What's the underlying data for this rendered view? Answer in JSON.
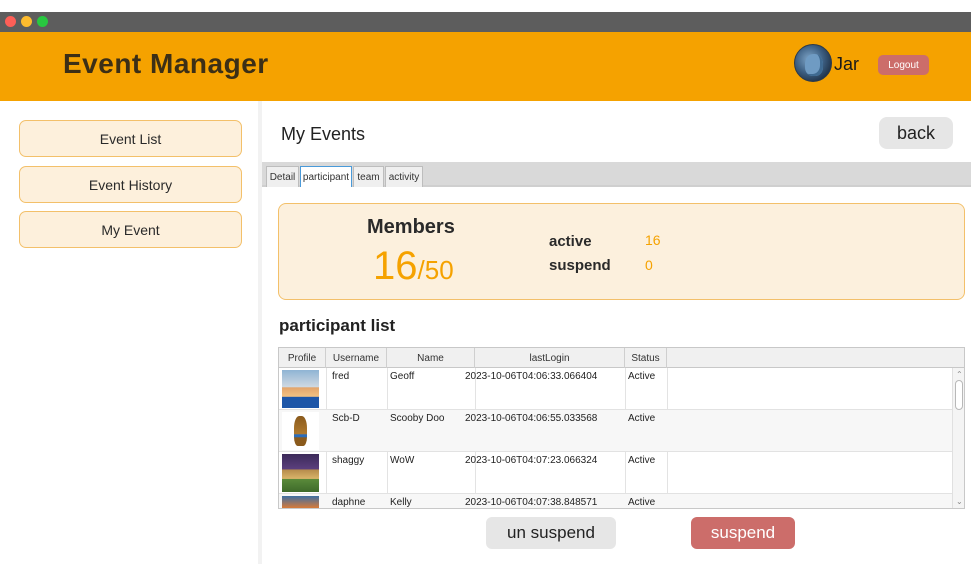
{
  "header": {
    "app_title": "Event Manager",
    "user_name": "Jar",
    "logout_label": "Logout"
  },
  "sidebar": {
    "items": [
      {
        "label": "Event List"
      },
      {
        "label": "Event History"
      },
      {
        "label": "My Event"
      }
    ]
  },
  "main": {
    "page_title": "My Events",
    "back_label": "back",
    "tabs": [
      {
        "label": "Detail"
      },
      {
        "label": "participant"
      },
      {
        "label": "team"
      },
      {
        "label": "activity"
      }
    ],
    "members": {
      "label": "Members",
      "current": "16",
      "separator": "/",
      "max": "50",
      "active_label": "active",
      "active_value": "16",
      "suspend_label": "suspend",
      "suspend_value": "0"
    },
    "list_title": "participant list",
    "table": {
      "columns": [
        "Profile",
        "Username",
        "Name",
        "lastLogin",
        "Status"
      ],
      "rows": [
        {
          "username": "fred",
          "name": "Geoff",
          "last_login": "2023-10-06T04:06:33.066404",
          "status": "Active"
        },
        {
          "username": "Scb-D",
          "name": "Scooby Doo",
          "last_login": "2023-10-06T04:06:55.033568",
          "status": "Active"
        },
        {
          "username": "shaggy",
          "name": "WoW",
          "last_login": "2023-10-06T04:07:23.066324",
          "status": "Active"
        },
        {
          "username": "daphne",
          "name": "Kelly",
          "last_login": "2023-10-06T04:07:38.848571",
          "status": "Active"
        }
      ]
    },
    "unsuspend_label": "un suspend",
    "suspend_label": "suspend"
  },
  "colors": {
    "accent": "#f5a200",
    "danger": "#cc6d6a",
    "card_bg": "#fcf0dd"
  }
}
